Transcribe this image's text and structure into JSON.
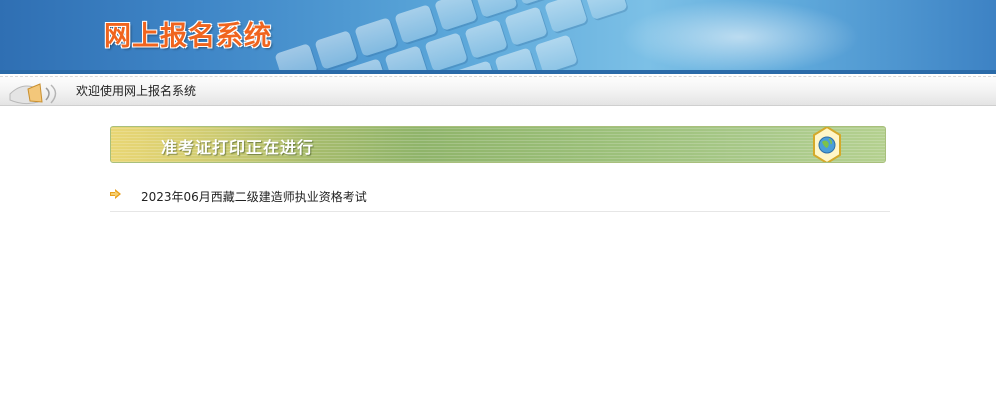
{
  "banner": {
    "title": "网上报名系统"
  },
  "welcome_bar": {
    "text": "欢迎使用网上报名系统",
    "icon": "speaker-icon"
  },
  "section": {
    "title": "准考证打印正在进行",
    "badge_icon": "globe-badge-icon"
  },
  "exam_list": [
    {
      "label": "2023年06月西藏二级建造师执业资格考试",
      "icon": "arrow-bullet-icon"
    }
  ],
  "colors": {
    "banner_title": "#f0641e",
    "banner_blue": "#3f86c7",
    "section_green": "#8fb46a"
  }
}
